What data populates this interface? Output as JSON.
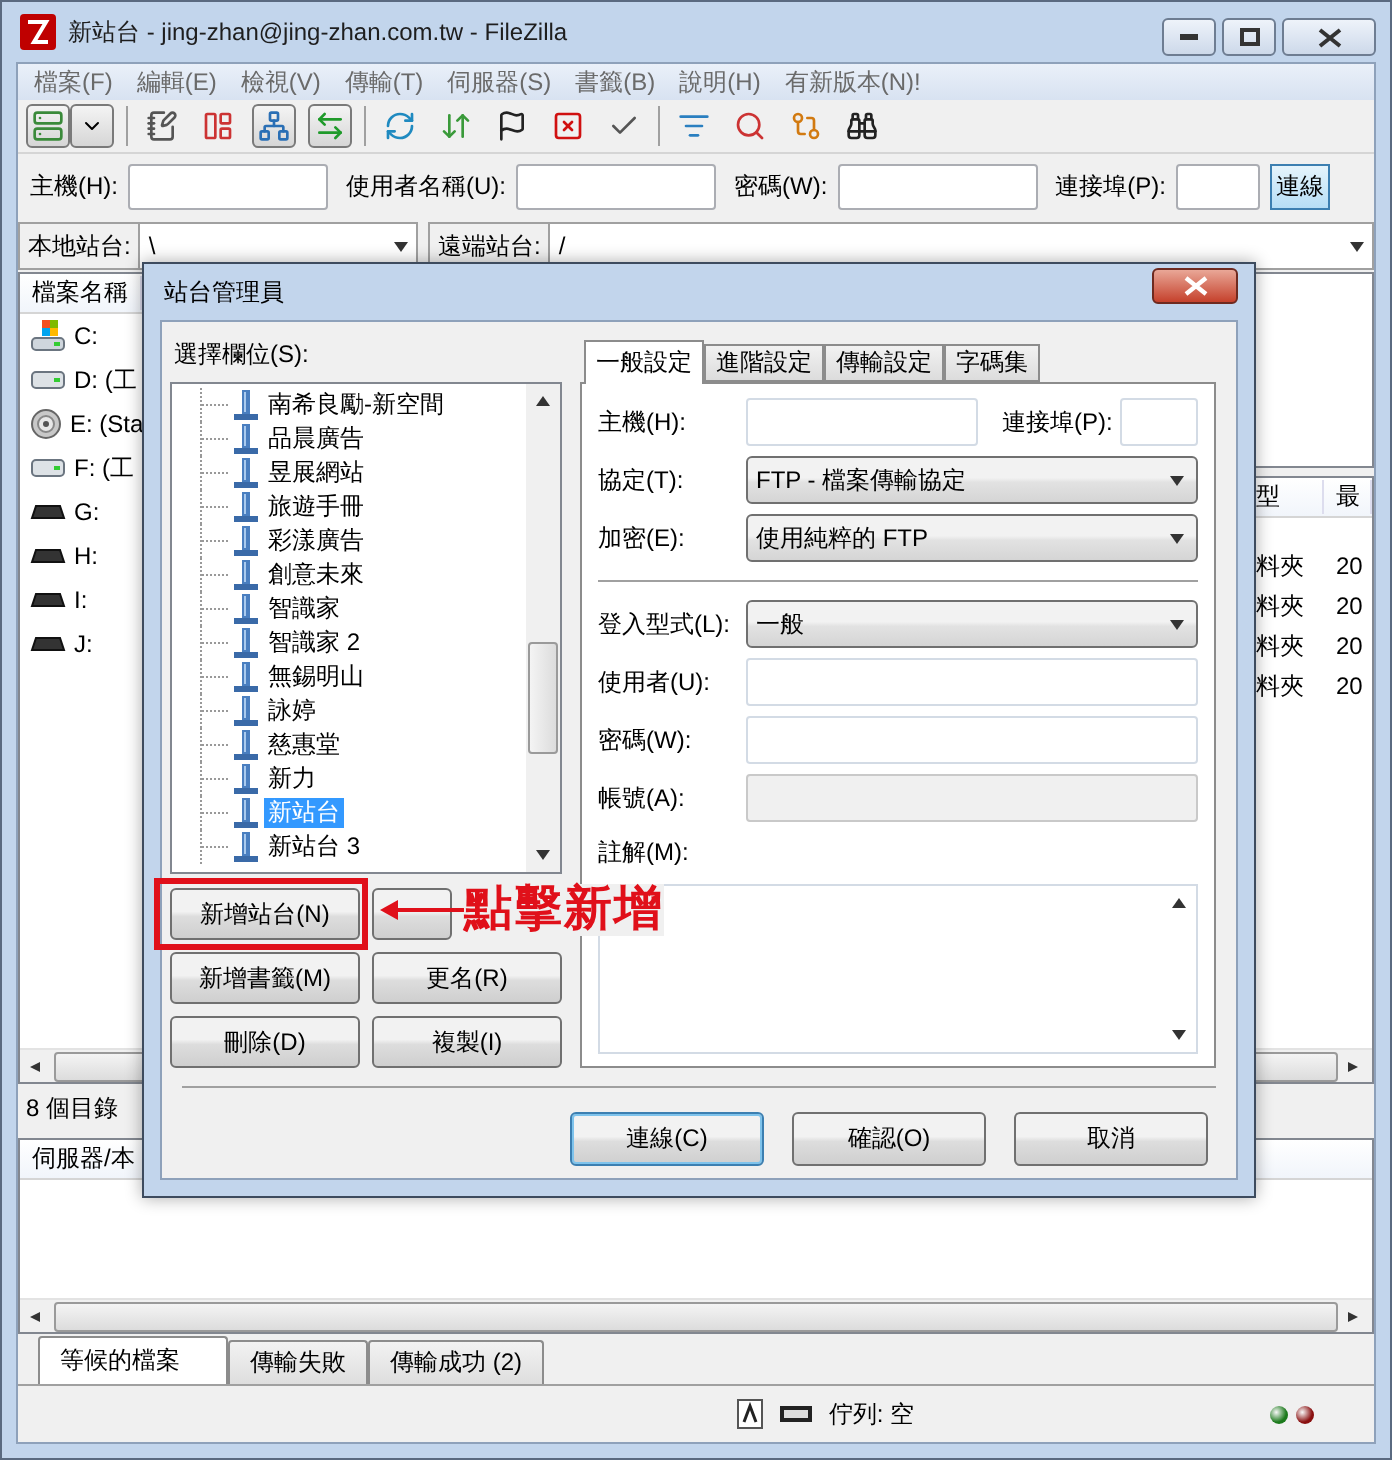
{
  "window": {
    "title": "新站台 - jing-zhan@jing-zhan.com.tw - FileZilla"
  },
  "menu": [
    "檔案(F)",
    "編輯(E)",
    "檢視(V)",
    "傳輸(T)",
    "伺服器(S)",
    "書籤(B)",
    "說明(H)",
    "有新版本(N)!"
  ],
  "quickconnect": {
    "fields": [
      {
        "label": "主機(H):",
        "kind": "wide"
      },
      {
        "label": "使用者名稱(U):",
        "kind": "wide"
      },
      {
        "label": "密碼(W):",
        "kind": "wide"
      },
      {
        "label": "連接埠(P):",
        "kind": "narrow"
      }
    ],
    "button": "連線"
  },
  "local_site": {
    "label": "本地站台:",
    "value": "\\"
  },
  "remote_site": {
    "label": "遠端站台:",
    "value": "/"
  },
  "local_list": {
    "column": "檔案名稱",
    "rows": [
      {
        "name": "C:",
        "kind": "system"
      },
      {
        "name": "D: (工",
        "kind": "hdd"
      },
      {
        "name": "E: (Sta",
        "kind": "cd"
      },
      {
        "name": "F: (工",
        "kind": "hdd"
      },
      {
        "name": "G:",
        "kind": "removable"
      },
      {
        "name": "H:",
        "kind": "removable"
      },
      {
        "name": "I:",
        "kind": "removable"
      },
      {
        "name": "J:",
        "kind": "removable"
      }
    ]
  },
  "remote_list": {
    "columns": [
      "型",
      "最"
    ],
    "rows": [
      [
        "料夾",
        "20"
      ],
      [
        "料夾",
        "20"
      ],
      [
        "料夾",
        "20"
      ],
      [
        "料夾",
        "20"
      ]
    ]
  },
  "status_line": "8 個目錄",
  "queue": {
    "column": "伺服器/本"
  },
  "queue_tabs": [
    {
      "label": "等候的檔案",
      "selected": true
    },
    {
      "label": "傳輸失敗",
      "selected": false
    },
    {
      "label": "傳輸成功 (2)",
      "selected": false
    }
  ],
  "status_bar": {
    "queue": "佇列: 空"
  },
  "dialog": {
    "title": "站台管理員",
    "tree_label": "選擇欄位(S):",
    "sites": [
      {
        "name": "南希良勵-新空間",
        "selected": false
      },
      {
        "name": "品晨廣告",
        "selected": false
      },
      {
        "name": "昱展網站",
        "selected": false
      },
      {
        "name": "旅遊手冊",
        "selected": false
      },
      {
        "name": "彩漾廣告",
        "selected": false
      },
      {
        "name": "創意未來",
        "selected": false
      },
      {
        "name": "智識家",
        "selected": false
      },
      {
        "name": "智識家 2",
        "selected": false
      },
      {
        "name": "無錫明山",
        "selected": false
      },
      {
        "name": "詠婷",
        "selected": false
      },
      {
        "name": "慈惠堂",
        "selected": false
      },
      {
        "name": "新力",
        "selected": false
      },
      {
        "name": "新站台",
        "selected": true
      },
      {
        "name": "新站台 3",
        "selected": false
      }
    ],
    "buttons": [
      {
        "label": "新增站台(N)",
        "highlighted": true
      },
      {
        "kind": "covered",
        "highlighted": false
      },
      {
        "label": "新增書籤(M)",
        "highlighted": false
      },
      {
        "label": "更名(R)",
        "highlighted": false
      },
      {
        "label": "刪除(D)",
        "highlighted": false
      },
      {
        "label": "複製(I)",
        "highlighted": false
      }
    ],
    "tabs": [
      {
        "label": "一般設定",
        "selected": true
      },
      {
        "label": "進階設定",
        "selected": false
      },
      {
        "label": "傳輸設定",
        "selected": false
      },
      {
        "label": "字碼集",
        "selected": false
      }
    ],
    "host": {
      "label": "主機(H):"
    },
    "port": {
      "label": "連接埠(P):"
    },
    "fields": [
      {
        "kind": "select",
        "label": "協定(T):",
        "value": "FTP - 檔案傳輸協定"
      },
      {
        "kind": "select",
        "label": "加密(E):",
        "value": "使用純粹的 FTP"
      },
      {
        "kind": "separator"
      },
      {
        "kind": "select",
        "label": "登入型式(L):",
        "value": "一般"
      },
      {
        "kind": "input",
        "label": "使用者(U):",
        "disabled": false
      },
      {
        "kind": "input",
        "label": "密碼(W):",
        "disabled": false
      },
      {
        "kind": "input",
        "label": "帳號(A):",
        "disabled": true
      }
    ],
    "comments": {
      "label": "註解(M):"
    },
    "actions": [
      {
        "label": "連線(C)",
        "default": true
      },
      {
        "label": "確認(O)",
        "default": false
      },
      {
        "label": "取消",
        "default": false
      }
    ],
    "annotation": {
      "text": "點擊新增"
    }
  }
}
